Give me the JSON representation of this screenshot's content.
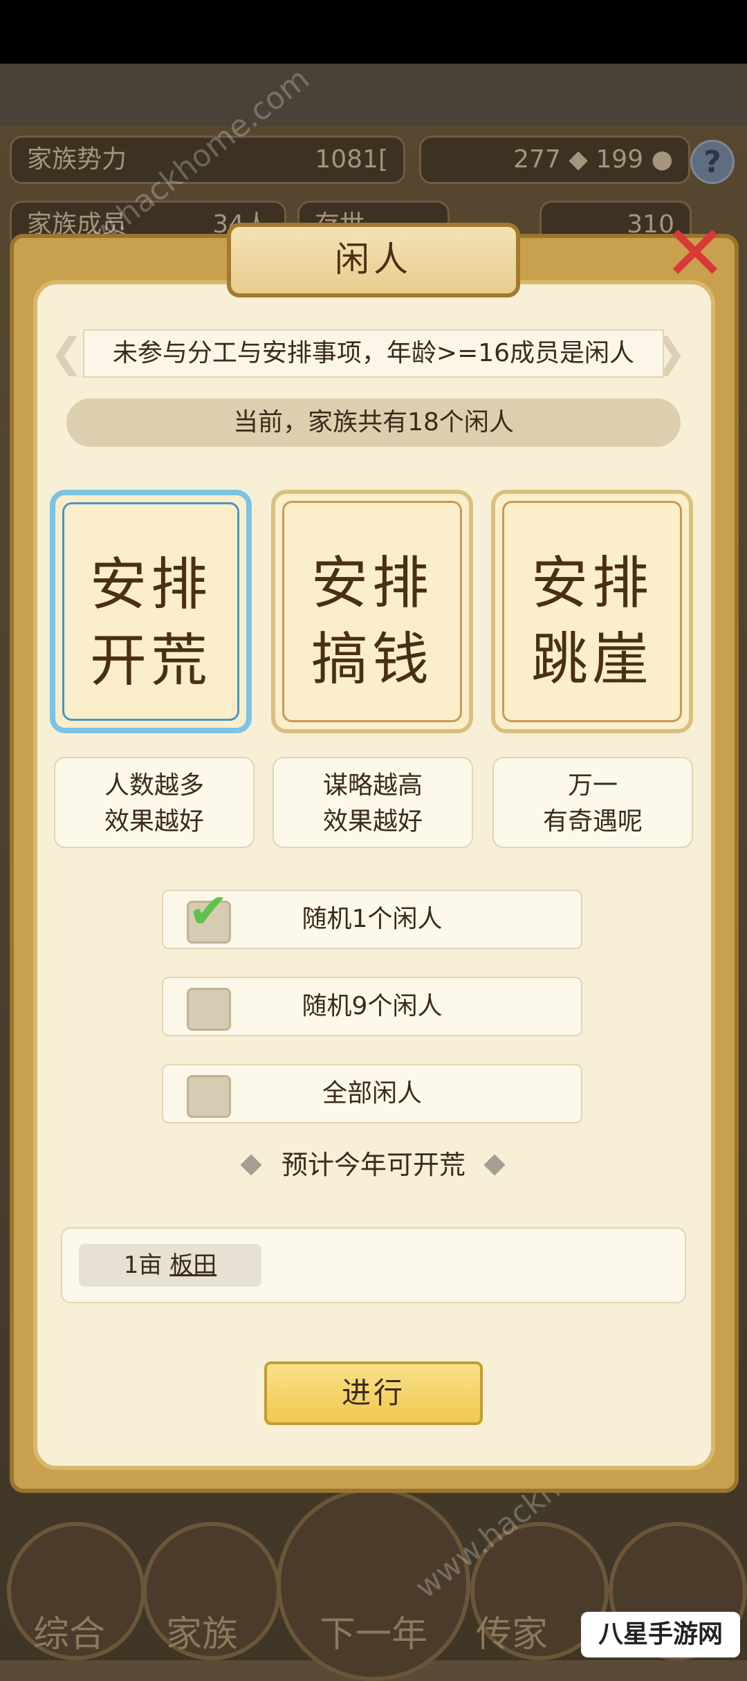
{
  "background": {
    "stats": {
      "family_power_label": "家族势力",
      "family_power_value": "1081[",
      "silver": "277",
      "gold": "199",
      "members_label": "家族成员",
      "members_value": "34人",
      "year_label": "存世",
      "ingots": "310"
    },
    "nav": [
      "综合",
      "家族",
      "下一年",
      "传家"
    ],
    "watermark": "www.hackhome.com",
    "brand": "八星手游网"
  },
  "dialog": {
    "title": "闲人",
    "description": "未参与分工与安排事项，年龄>=16成员是闲人",
    "count_text": "当前，家族共有18个闲人",
    "cards": [
      {
        "line1": "安排",
        "line2": "开荒",
        "note1": "人数越多",
        "note2": "效果越好",
        "selected": true
      },
      {
        "line1": "安排",
        "line2": "搞钱",
        "note1": "谋略越高",
        "note2": "效果越好",
        "selected": false
      },
      {
        "line1": "安排",
        "line2": "跳崖",
        "note1": "万一",
        "note2": "有奇遇呢",
        "selected": false
      }
    ],
    "options": [
      {
        "label": "随机1个闲人",
        "checked": true
      },
      {
        "label": "随机9个闲人",
        "checked": false
      },
      {
        "label": "全部闲人",
        "checked": false
      }
    ],
    "expect_label": "预计今年可开荒",
    "result": {
      "amount": "1亩",
      "item": "板田"
    },
    "confirm_label": "进行",
    "colors": {
      "selected_border": "#7cc3e6",
      "check": "#5fc24a",
      "button": "#efc94f"
    }
  }
}
